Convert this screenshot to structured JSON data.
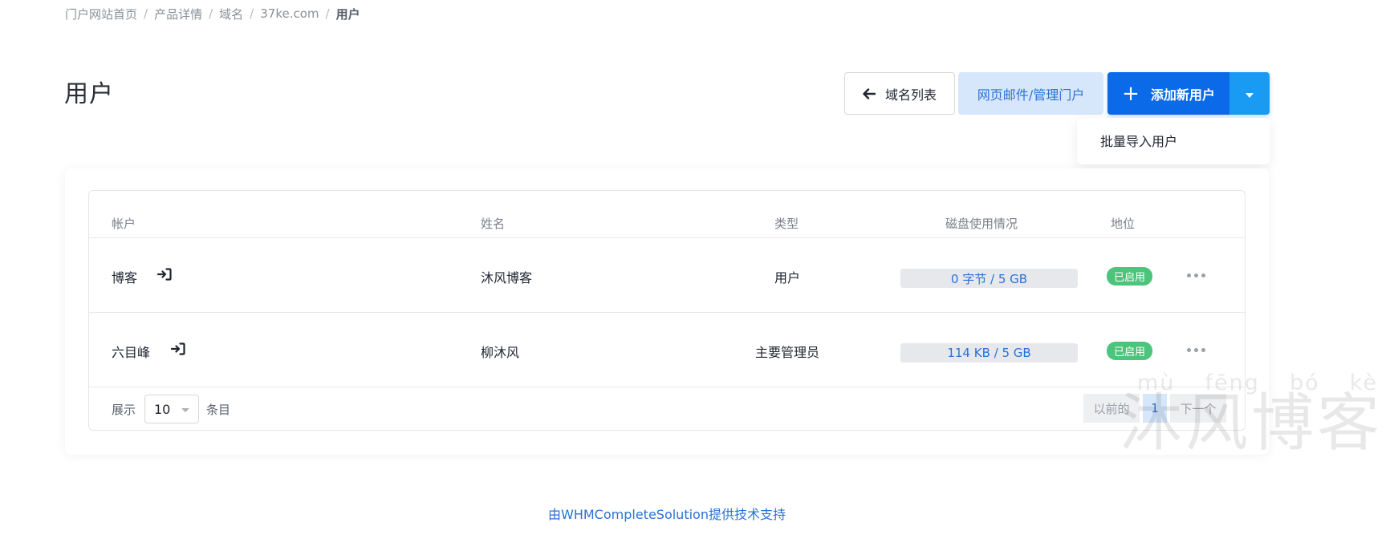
{
  "breadcrumb": {
    "items": [
      "门户网站首页",
      "产品详情",
      "域名",
      "37ke.com"
    ],
    "current": "用户",
    "separator": "/"
  },
  "page_title": "用户",
  "actions": {
    "back_label": "域名列表",
    "portal_label": "网页邮件/管理门户",
    "add_label": "添加新用户",
    "dropdown_item": "批量导入用户"
  },
  "table": {
    "headers": {
      "account": "帐户",
      "name": "姓名",
      "type": "类型",
      "disk": "磁盘使用情况",
      "status": "地位"
    },
    "rows": [
      {
        "account": "博客",
        "name": "沐风博客",
        "type": "用户",
        "disk": "0 字节 / 5 GB",
        "status": "已启用"
      },
      {
        "account": "六目峰",
        "name": "柳沐风",
        "type": "主要管理员",
        "disk": "114 KB / 5 GB",
        "status": "已启用"
      }
    ]
  },
  "pagination": {
    "show_label": "展示",
    "page_size": "10",
    "entries_label": "条目",
    "prev_label": "以前的",
    "current_page": "1",
    "next_label": "下一个"
  },
  "watermark": {
    "pinyin": [
      "mù",
      "fēng",
      "bó",
      "kè"
    ],
    "text": "沐风博客"
  },
  "footer": {
    "text": "由WHMCompleteSolution提供技术支持"
  },
  "colors": {
    "primary": "#0a6ae8",
    "secondary": "#1a9bf3",
    "badge_enabled": "#4cc47b",
    "link": "#2a72d6"
  }
}
